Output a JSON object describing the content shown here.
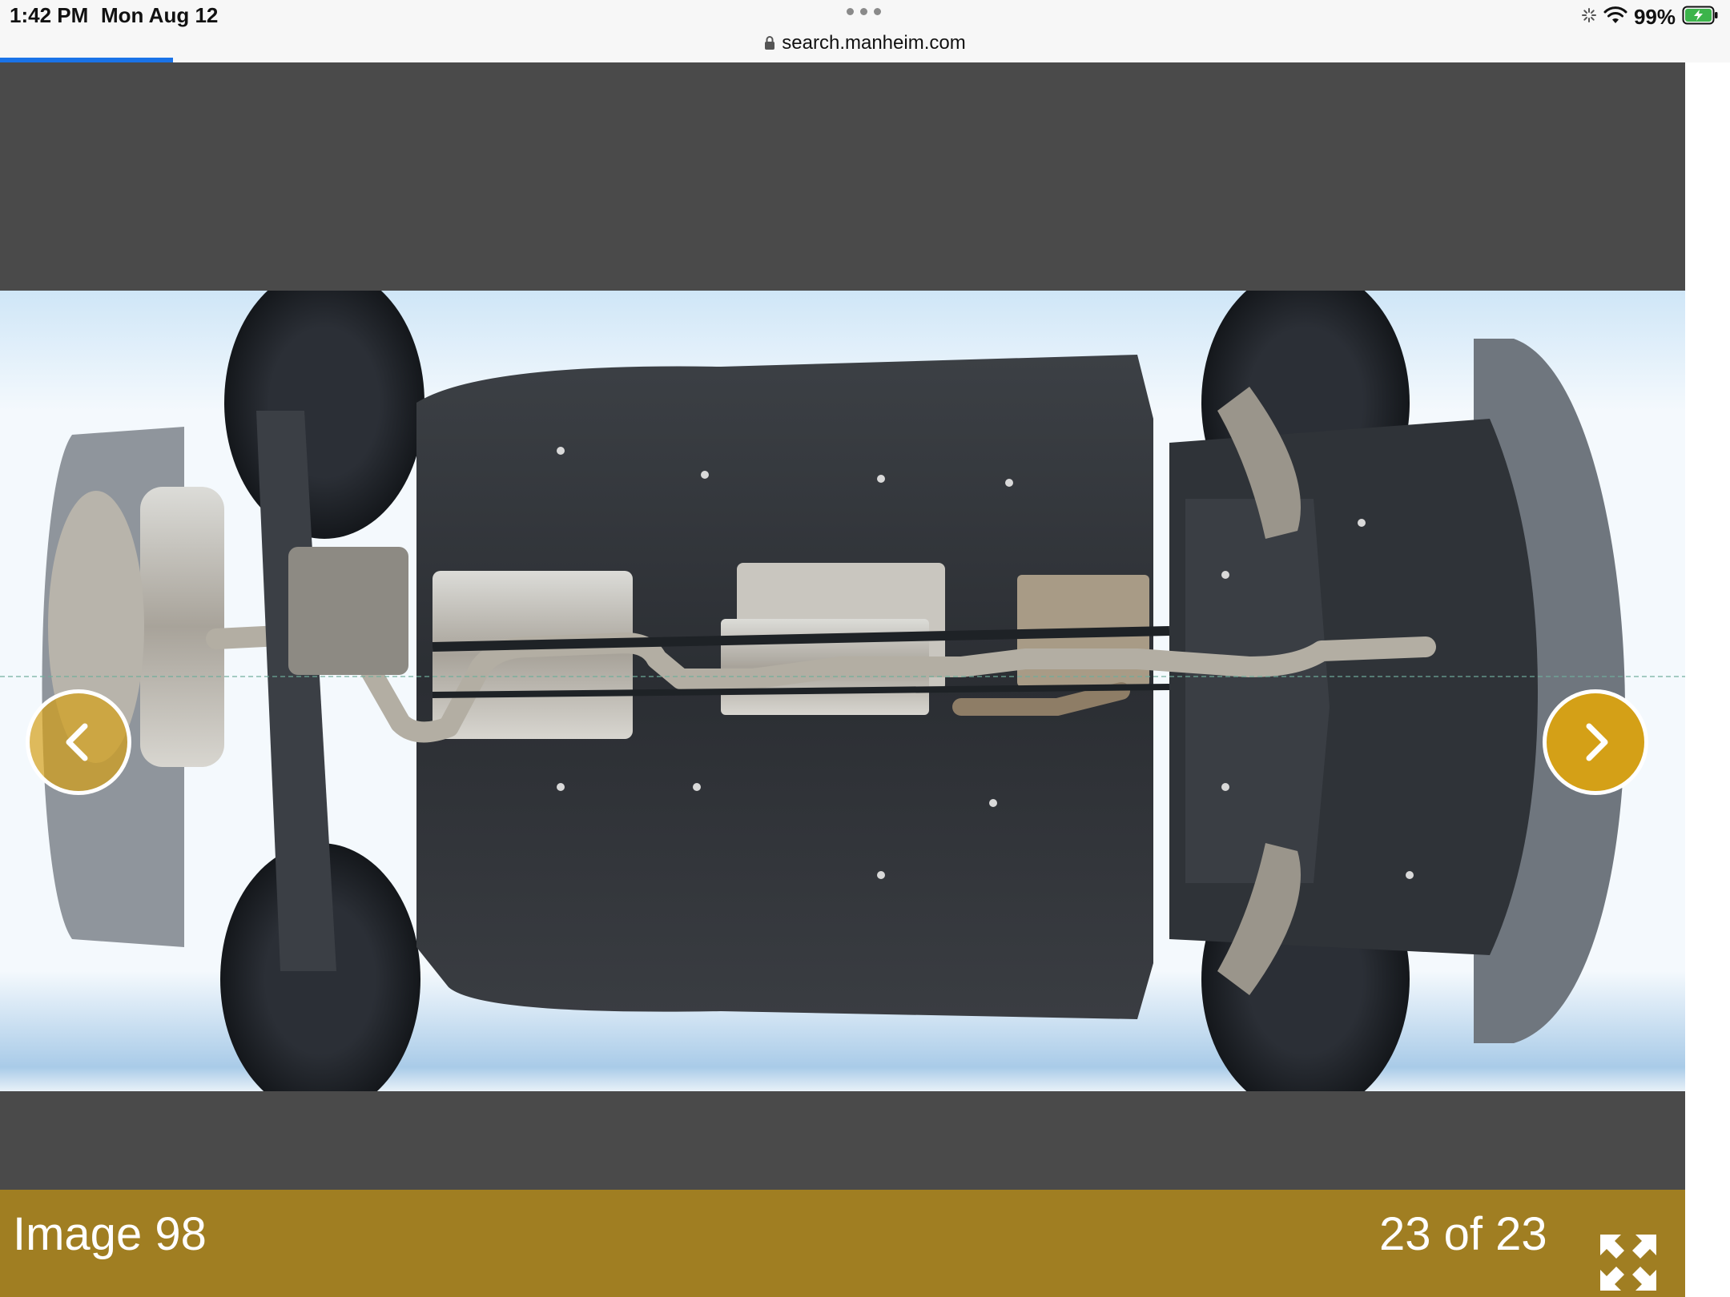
{
  "status_bar": {
    "time": "1:42 PM",
    "date": "Mon Aug 12",
    "url": "search.manheim.com",
    "battery": "99%",
    "icons": [
      "activity-spinner-icon",
      "wifi-icon",
      "battery-charging-icon"
    ],
    "load_progress": 0.1
  },
  "viewer": {
    "image_alt": "Vehicle undercarriage photo",
    "caption": "Image 98",
    "counter": "23 of 23",
    "prev_icon": "chevron-left-icon",
    "next_icon": "chevron-right-icon",
    "expand_icon": "expand-icon"
  },
  "colors": {
    "accent": "#d4a017",
    "caption_bar": "#a07e22",
    "viewer_bg": "#4a4a4a",
    "url_progress": "#1a73e8"
  }
}
